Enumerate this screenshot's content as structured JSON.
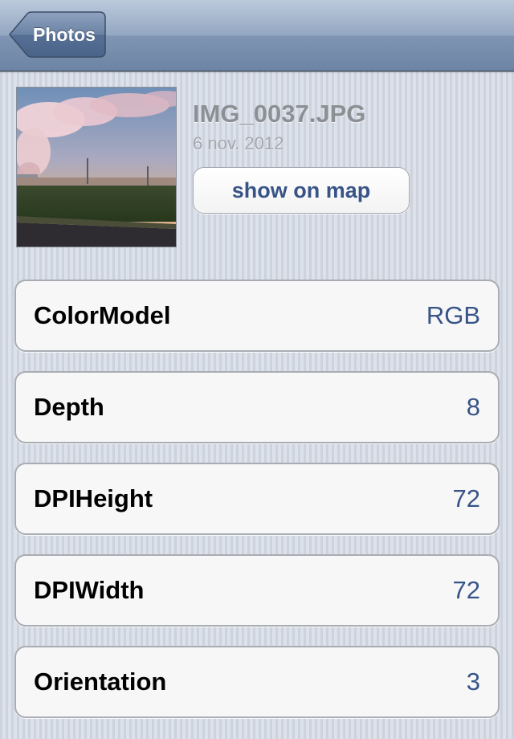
{
  "navbar": {
    "back_label": "Photos"
  },
  "photo": {
    "filename": "IMG_0037.JPG",
    "date": "6 nov. 2012",
    "show_on_map_label": "show on map"
  },
  "properties": [
    {
      "name": "ColorModel",
      "value": "RGB"
    },
    {
      "name": "Depth",
      "value": "8"
    },
    {
      "name": "DPIHeight",
      "value": "72"
    },
    {
      "name": "DPIWidth",
      "value": "72"
    },
    {
      "name": "Orientation",
      "value": "3"
    }
  ],
  "colors": {
    "navbar_top": "#bcc9db",
    "navbar_bottom": "#6d84a4",
    "value_text": "#385487",
    "background": "#d7dce6"
  }
}
